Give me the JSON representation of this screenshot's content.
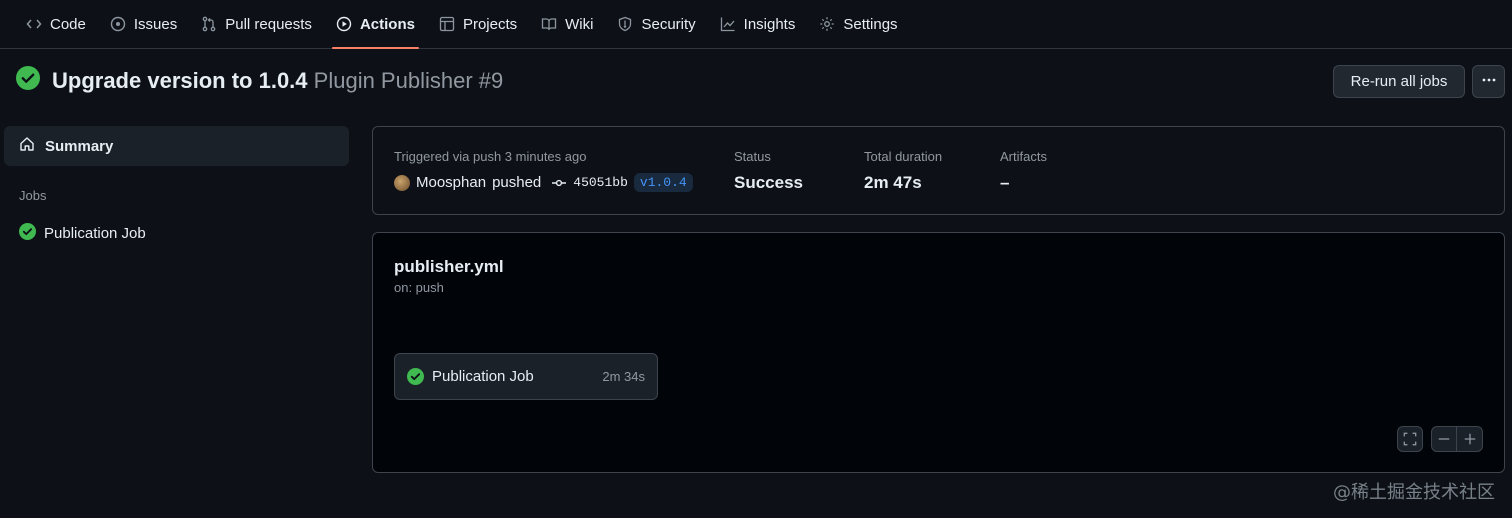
{
  "nav": {
    "tabs": [
      {
        "label": "Code",
        "icon": "code-icon"
      },
      {
        "label": "Issues",
        "icon": "issue-icon"
      },
      {
        "label": "Pull requests",
        "icon": "pull-request-icon"
      },
      {
        "label": "Actions",
        "icon": "play-icon",
        "active": true
      },
      {
        "label": "Projects",
        "icon": "table-icon"
      },
      {
        "label": "Wiki",
        "icon": "book-icon"
      },
      {
        "label": "Security",
        "icon": "shield-icon"
      },
      {
        "label": "Insights",
        "icon": "graph-icon"
      },
      {
        "label": "Settings",
        "icon": "gear-icon"
      }
    ]
  },
  "run": {
    "title": "Upgrade version to 1.0.4",
    "workflow_name": "Plugin Publisher #9",
    "rerun_label": "Re-run all jobs"
  },
  "sidebar": {
    "summary_label": "Summary",
    "jobs_heading": "Jobs",
    "jobs": [
      {
        "label": "Publication Job",
        "status": "success"
      }
    ]
  },
  "summary": {
    "trigger_text": "Triggered via push 3 minutes ago",
    "actor": "Moosphan",
    "action": "pushed",
    "commit_sha": "45051bb",
    "tag": "v1.0.4",
    "status_label": "Status",
    "status_value": "Success",
    "duration_label": "Total duration",
    "duration_value": "2m 47s",
    "artifacts_label": "Artifacts",
    "artifacts_value": "–"
  },
  "workflow": {
    "file": "publisher.yml",
    "trigger": "on: push",
    "job": {
      "label": "Publication Job",
      "duration": "2m 34s"
    }
  },
  "watermark": "@稀土掘金技术社区",
  "colors": {
    "success": "#3fb950",
    "accent_underline": "#f78166",
    "background": "#0d1117",
    "link": "#4493f8"
  }
}
